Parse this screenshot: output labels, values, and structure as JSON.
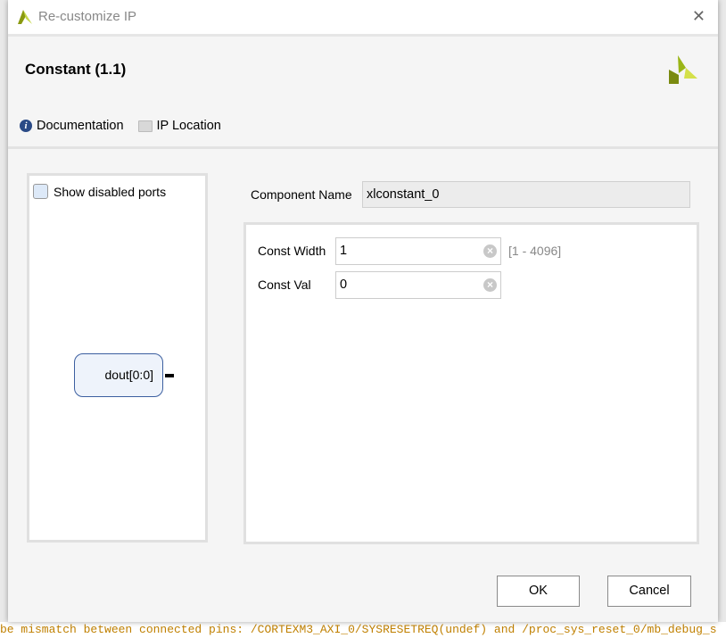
{
  "window": {
    "title": "Re-customize IP",
    "close": "✕"
  },
  "header": {
    "title": "Constant (1.1)",
    "documentation": "Documentation",
    "ip_location": "IP Location"
  },
  "symbol": {
    "show_disabled_ports": "Show disabled ports",
    "show_disabled_checked": false,
    "port": "dout[0:0]"
  },
  "form": {
    "component_name_label": "Component Name",
    "component_name": "xlconstant_0",
    "const_width_label": "Const Width",
    "const_width": "1",
    "const_width_range": "[1 - 4096]",
    "const_val_label": "Const Val",
    "const_val": "0"
  },
  "buttons": {
    "ok": "OK",
    "cancel": "Cancel"
  },
  "background": {
    "log_line": "be mismatch between connected pins: /CORTEXM3_AXI_0/SYSRESETREQ(undef) and /proc_sys_reset_0/mb_debug_s"
  },
  "colors": {
    "accent": "#2a4a86",
    "logo": "#9ab516"
  }
}
